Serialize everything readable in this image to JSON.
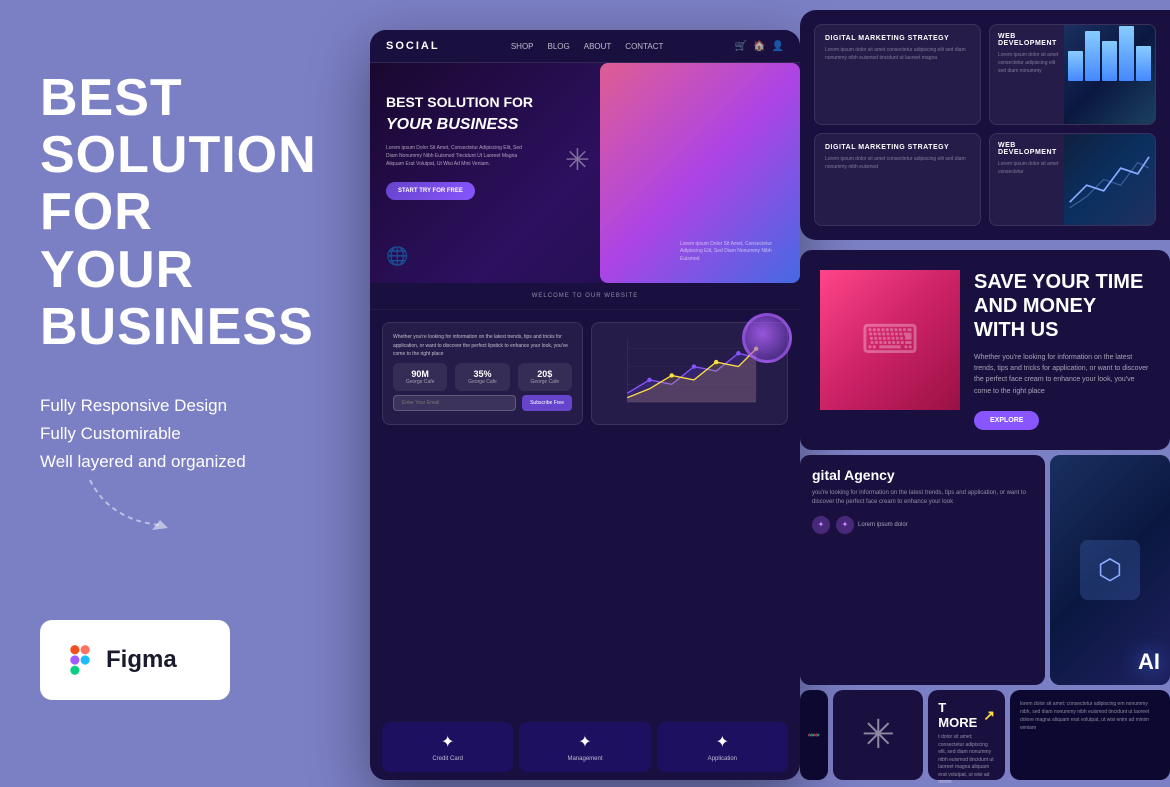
{
  "left": {
    "title_line1": "BEST SOLUTION FOR",
    "title_line2": "YOUR BUSINESS",
    "features": [
      "Fully Responsive Design",
      "Fully Customirable",
      "Well layered and organized"
    ],
    "figma_label": "Figma"
  },
  "mockup": {
    "nav": {
      "logo": "SOCIAL",
      "links": [
        "SHOP",
        "BLOG",
        "ABOUT",
        "CONTACT"
      ]
    },
    "hero": {
      "title": "BEST SOLUTION FOR",
      "title_italic": "YOUR BUSINESS",
      "desc": "Lorem ipsum Dolor Sit Amet, Consectetur Adipiscing Elit, Sed Diam Nonummy Nibh Euismod Tincidunt Ut Laoreet Magna Aliquam Erat Volutpat, Ut Wisi Ad Mini Veniam.",
      "button": "START TRY FOR FREE"
    },
    "welcome": "WELCOME TO OUR WEBSITE",
    "card_text": "Whether you're looking for information on the latest trends, tips and tricks for application, or want to discover the perfect lipstick to enhance your look, you've come to the right place",
    "stats": [
      {
        "value": "90M",
        "label": "George Cafe"
      },
      {
        "value": "35%",
        "label": "George Cafe"
      },
      {
        "value": "20$",
        "label": "George Cafe"
      }
    ],
    "email_placeholder": "Enter Your Email",
    "subscribe_btn": "Subscribe Free",
    "bottom_icons": [
      {
        "icon": "✦",
        "label": "Credit Card"
      },
      {
        "icon": "✦",
        "label": "Management"
      },
      {
        "icon": "✦",
        "label": "Application"
      }
    ]
  },
  "right": {
    "top_cards": [
      {
        "title": "DIGITAL MARKETING STRATEGY",
        "text": "Lorem ipsum dolor sit amet consectetur adipiscing elit sed diam nonummy nibh euismod tincidunt ut laoreet magna"
      },
      {
        "title": "WEB DEVELOPMENT",
        "text": "Lorem ipsum dolor sit amet consectetur adipiscing elit sed diam nonummy"
      },
      {
        "title": "DIGITAL MARKETING STRATEGY",
        "text": "Lorem ipsum dolor sit amet consectetur adipiscing elit sed diam nonummy nibh euismod"
      },
      {
        "title": "WEB DEVELOPMENT",
        "text": "Lorem ipsum dolor sit amet consectetur"
      }
    ],
    "save_title": "SAVE YOUR TIME AND MONEY WITH US",
    "save_text": "Whether you're looking for information on the latest trends, tips and tricks for application, or want to discover the perfect face cream to enhance your look, you've come to the right place",
    "explore_btn": "EXPLORE",
    "agency_title": "gital Agency",
    "agency_text": "you're looking for information on the latest trends, tips and application, or want to discover the perfect face cream to enhance your look",
    "services": [
      "Lorem ipsum dolor",
      "Lorem ipsum dolor"
    ],
    "ai_label": "AI",
    "more_title": "T MORE",
    "more_text": "t dolor sit amet; consectetur adipiscing elit, sed diam nonummy nibh euismod tincidunt ut laoreet magna aliquam erat volutpat, ut wisi ad minim",
    "text_card_content": "lorem dolor sit amet; consectetur adipiscing em nonummy nibh, sed diam nonummy nibh euismod tincidunt ut laoreet dolore magna aliquam erat volutpat, ut wisi enim ad minim veniam"
  },
  "colors": {
    "bg_main": "#7B7FC4",
    "dark_bg": "#1a1040",
    "accent_purple": "#8855ff",
    "accent_pink": "#ff6b9d"
  }
}
